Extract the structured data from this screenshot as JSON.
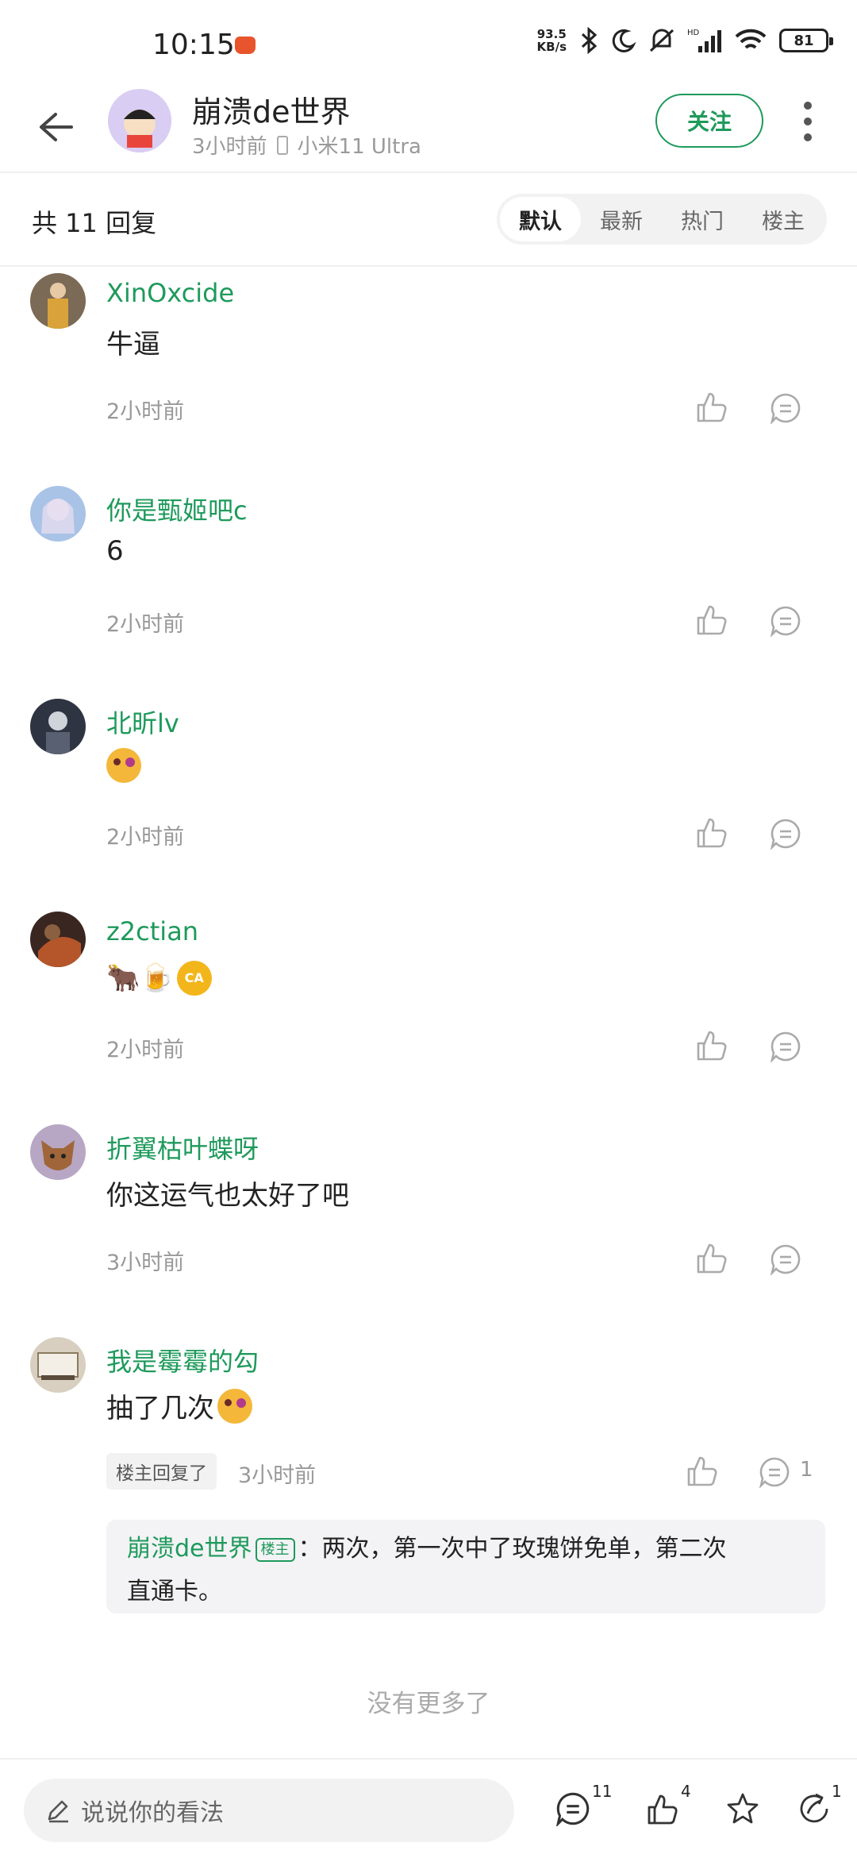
{
  "status_bar": {
    "time": "10:15",
    "net_speed_top": "93.5",
    "net_speed_unit": "KB/s",
    "battery": "81"
  },
  "header": {
    "username": "崩溃de世界",
    "time_ago": "3小时前",
    "device": "小米11 Ultra",
    "follow_label": "关注"
  },
  "replies": {
    "count_label": "共 11 回复",
    "sort_tabs": [
      "默认",
      "最新",
      "热门",
      "楼主"
    ],
    "active_tab": "默认"
  },
  "comments": [
    {
      "name": "XinOxcide",
      "text": "牛逼",
      "time": "2小时前"
    },
    {
      "name": "你是甄姬吧c",
      "text": "6",
      "time": "2小时前"
    },
    {
      "name": "北昕lv",
      "text": "",
      "time": "2小时前"
    },
    {
      "name": "z2ctian",
      "text": "🐂🍺",
      "time": "2小时前"
    },
    {
      "name": "折翼枯叶蝶呀",
      "text": "你这运气也太好了吧",
      "time": "3小时前"
    },
    {
      "name": "我是霉霉的勾",
      "text": "抽了几次",
      "time": "3小时前",
      "owner_tag": "楼主回复了",
      "reply_count": "1"
    }
  ],
  "owner_reply": {
    "name": "崩溃de世界",
    "badge": "楼主",
    "text_line1": "：两次，第一次中了玫瑰饼免单，第二次",
    "text_line2": "直通卡。"
  },
  "no_more": "没有更多了",
  "bottom_bar": {
    "input_placeholder": "说说你的看法",
    "comment_count": "11",
    "like_count": "4",
    "share_count": "1"
  },
  "colors": {
    "accent": "#1e9a5b",
    "text": "#222222",
    "muted": "#999999"
  }
}
